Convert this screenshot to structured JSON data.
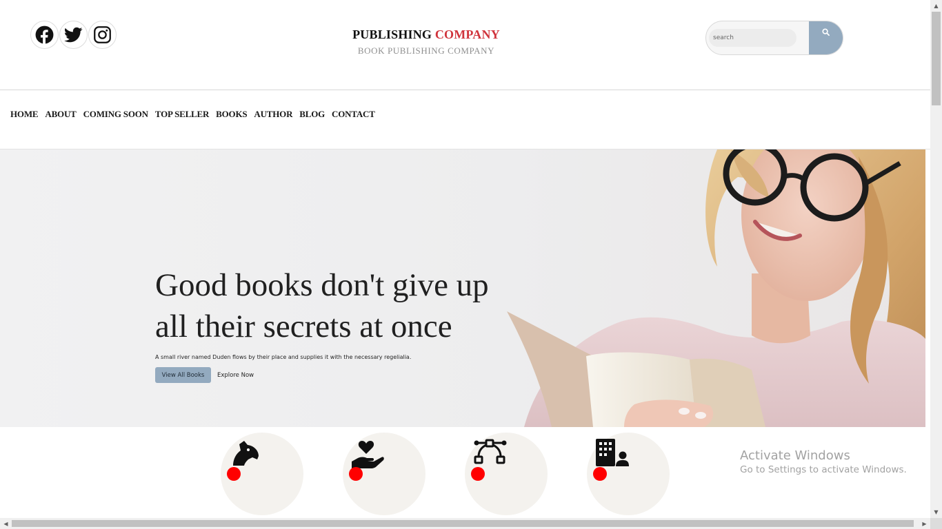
{
  "header": {
    "social": [
      {
        "icon": "facebook-icon"
      },
      {
        "icon": "twitter-icon"
      },
      {
        "icon": "instagram-icon"
      }
    ],
    "brand": {
      "title_main": "PUBLISHING",
      "title_accent": "COMPANY",
      "subtitle": "BOOK PUBLISHING COMPANY"
    },
    "search": {
      "placeholder": "search",
      "value": "",
      "button_icon": "search-icon"
    }
  },
  "nav": {
    "items": [
      "HOME",
      "ABOUT",
      "COMING SOON",
      "TOP SELLER",
      "BOOKS",
      "AUTHOR",
      "BLOG",
      "CONTACT"
    ]
  },
  "hero": {
    "title_line1": "Good books don't give up",
    "title_line2": "all their secrets at once",
    "description": "A small river named Duden flows by their place and supplies it with the necessary regelialia.",
    "primary_button": "View All Books",
    "secondary_link": "Explore Now"
  },
  "features": [
    {
      "icon": "chess-knight-icon"
    },
    {
      "icon": "hand-holding-heart-icon"
    },
    {
      "icon": "bezier-curve-icon"
    },
    {
      "icon": "building-user-icon"
    }
  ],
  "watermark": {
    "title": "Activate Windows",
    "subtitle": "Go to Settings to activate Windows."
  },
  "colors": {
    "accent_red": "#d0343c",
    "button_blue": "#93aabf",
    "feature_circle": "#f4f2ee",
    "dot_red": "#ff0000"
  }
}
